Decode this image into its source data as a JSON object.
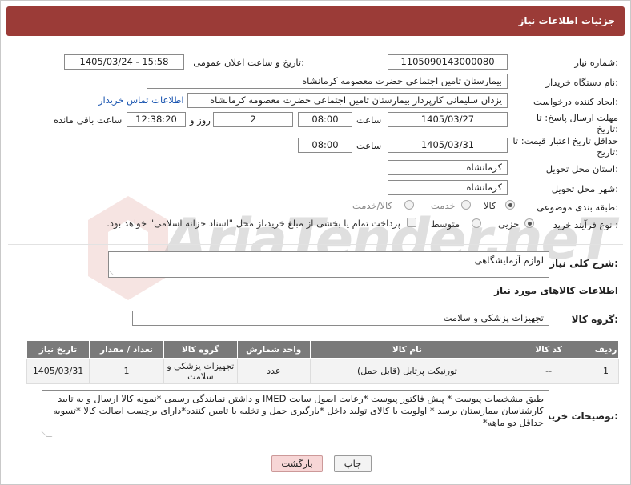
{
  "header": {
    "title": "جزئیات اطلاعات نیاز"
  },
  "fields": {
    "need_number": {
      "label": "شماره نیاز:",
      "value": "1105090143000080"
    },
    "announce_datetime": {
      "label": "تاریخ و ساعت اعلان عمومی:",
      "value": "1405/03/24 - 15:58"
    },
    "buyer_org": {
      "label": "نام دستگاه خریدار:",
      "value": "بیمارستان تامین اجتماعی حضرت معصومه کرمانشاه"
    },
    "requester": {
      "label": "ایجاد کننده درخواست:",
      "value": "یزدان  سلیمانی کارپرداز بیمارستان تامین اجتماعی حضرت معصومه کرمانشاه",
      "contact_link": "اطلاعات تماس خریدار"
    },
    "deadline": {
      "label": "مهلت ارسال پاسخ: تا تاریخ:",
      "date": "1405/03/27",
      "time_label": "ساعت",
      "time": "08:00",
      "days": "2",
      "days_label": "روز و",
      "remaining": "12:38:20",
      "remaining_label": "ساعت باقی مانده"
    },
    "min_validity": {
      "label": "حداقل تاریخ اعتبار قیمت: تا تاریخ:",
      "date": "1405/03/31",
      "time_label": "ساعت",
      "time": "08:00"
    },
    "province": {
      "label": "استان محل تحویل:",
      "value": "کرمانشاه"
    },
    "city": {
      "label": "شهر محل تحویل:",
      "value": "کرمانشاه"
    },
    "category": {
      "label": "طبقه بندی موضوعی:",
      "options": [
        "کالا",
        "خدمت",
        "کالا/خدمت"
      ],
      "selected": 0
    },
    "process_type": {
      "label": "نوع فرآیند خرید :",
      "options": [
        "جزیی",
        "متوسط"
      ],
      "selected": 0,
      "payment_note": "پرداخت تمام یا بخشی از مبلغ خرید،از محل \"اسناد خزانه اسلامی\" خواهد بود."
    }
  },
  "need_description": {
    "label": "شرح کلی نیاز:",
    "value": "لوازم آزمایشگاهی"
  },
  "goods_info": {
    "label": "اطلاعات کالاهای مورد نیاز"
  },
  "goods_group": {
    "label": "گروه کالا:",
    "value": "تجهیزات پزشکی و سلامت"
  },
  "table": {
    "headers": [
      "ردیف",
      "کد کالا",
      "نام کالا",
      "واحد شمارش",
      "گروه کالا",
      "تعداد / مقدار",
      "تاریخ نیاز"
    ],
    "rows": [
      [
        "1",
        "--",
        "تورنیکت پرتابل (قابل حمل)",
        "عدد",
        "تجهیزات پزشکی و سلامت",
        "1",
        "1405/03/31"
      ]
    ]
  },
  "buyer_notes": {
    "label": "توضیحات خریدار:",
    "value": "طبق مشخصات پیوست * پیش فاکتور پیوست *رعایت اصول سایت IMED و داشتن نمایندگی رسمی *نمونه کالا ارسال و به تایید کارشناسان بیمارستان برسد * اولویت با کالای تولید داخل  *بارگیری حمل و تخلیه با تامین کننده*دارای برچسب اصالت کالا *تسویه حداقل دو ماهه*"
  },
  "buttons": {
    "print": "چاپ",
    "back": "بازگشت"
  },
  "watermark": {
    "text": "AriaTender.neT"
  },
  "colors": {
    "header_bg": "#9b3b37",
    "table_header_bg": "#7a7a7a",
    "link": "#1a55b0",
    "back_button_bg": "#f7d6d6"
  }
}
